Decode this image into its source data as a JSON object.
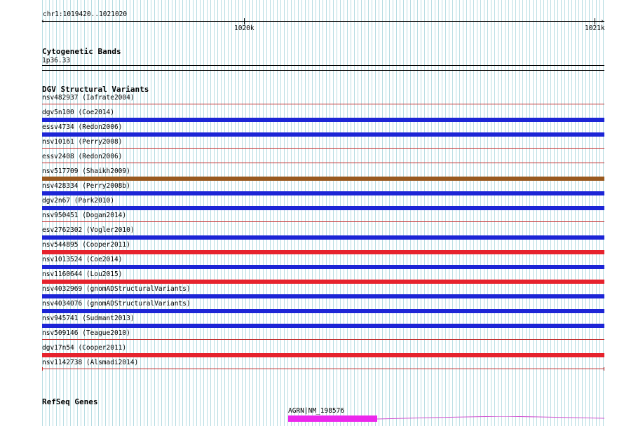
{
  "ruler": {
    "position": "chr1:1019420..1021020",
    "ticks": [
      {
        "label": "1020k"
      },
      {
        "label": "1021k"
      }
    ]
  },
  "cytoband": {
    "title": "Cytogenetic Bands",
    "band": "1p36.33"
  },
  "dgv": {
    "title": "DGV Structural Variants",
    "colors": {
      "loss": "#e6232d",
      "gain": "#1c25d6",
      "gain_loss": "#99591f",
      "thin": "#c12b2b"
    },
    "variants": [
      {
        "label": "nsv482937 (Iafrate2004)",
        "type": "thin"
      },
      {
        "label": "dgv5n100 (Coe2014)",
        "type": "gain"
      },
      {
        "label": "essv4734 (Redon2006)",
        "type": "gain"
      },
      {
        "label": "nsv10161 (Perry2008)",
        "type": "thin"
      },
      {
        "label": "essv2408 (Redon2006)",
        "type": "thin"
      },
      {
        "label": "nsv517709 (Shaikh2009)",
        "type": "gain_loss"
      },
      {
        "label": "nsv428334 (Perry2008b)",
        "type": "gain"
      },
      {
        "label": "dgv2n67 (Park2010)",
        "type": "gain"
      },
      {
        "label": "nsv950451 (Dogan2014)",
        "type": "thin"
      },
      {
        "label": "esv2762302 (Vogler2010)",
        "type": "gain"
      },
      {
        "label": "nsv544895 (Cooper2011)",
        "type": "loss"
      },
      {
        "label": "nsv1013524 (Coe2014)",
        "type": "gain"
      },
      {
        "label": "nsv1160644 (Lou2015)",
        "type": "loss"
      },
      {
        "label": "nsv4032969 (gnomADStructuralVariants)",
        "type": "gain"
      },
      {
        "label": "nsv4034076 (gnomADStructuralVariants)",
        "type": "gain"
      },
      {
        "label": "nsv945741 (Sudmant2013)",
        "type": "gain"
      },
      {
        "label": "nsv509146 (Teague2010)",
        "type": "thin"
      },
      {
        "label": "dgv17n54 (Cooper2011)",
        "type": "loss"
      },
      {
        "label": "nsv1142738 (Alsmadi2014)",
        "type": "thin_end"
      }
    ]
  },
  "refseq": {
    "title": "RefSeq Genes",
    "gene_label": "AGRN|NM_198576",
    "colors": {
      "exon": "#ec27ec",
      "intron": "#d050d0"
    }
  }
}
